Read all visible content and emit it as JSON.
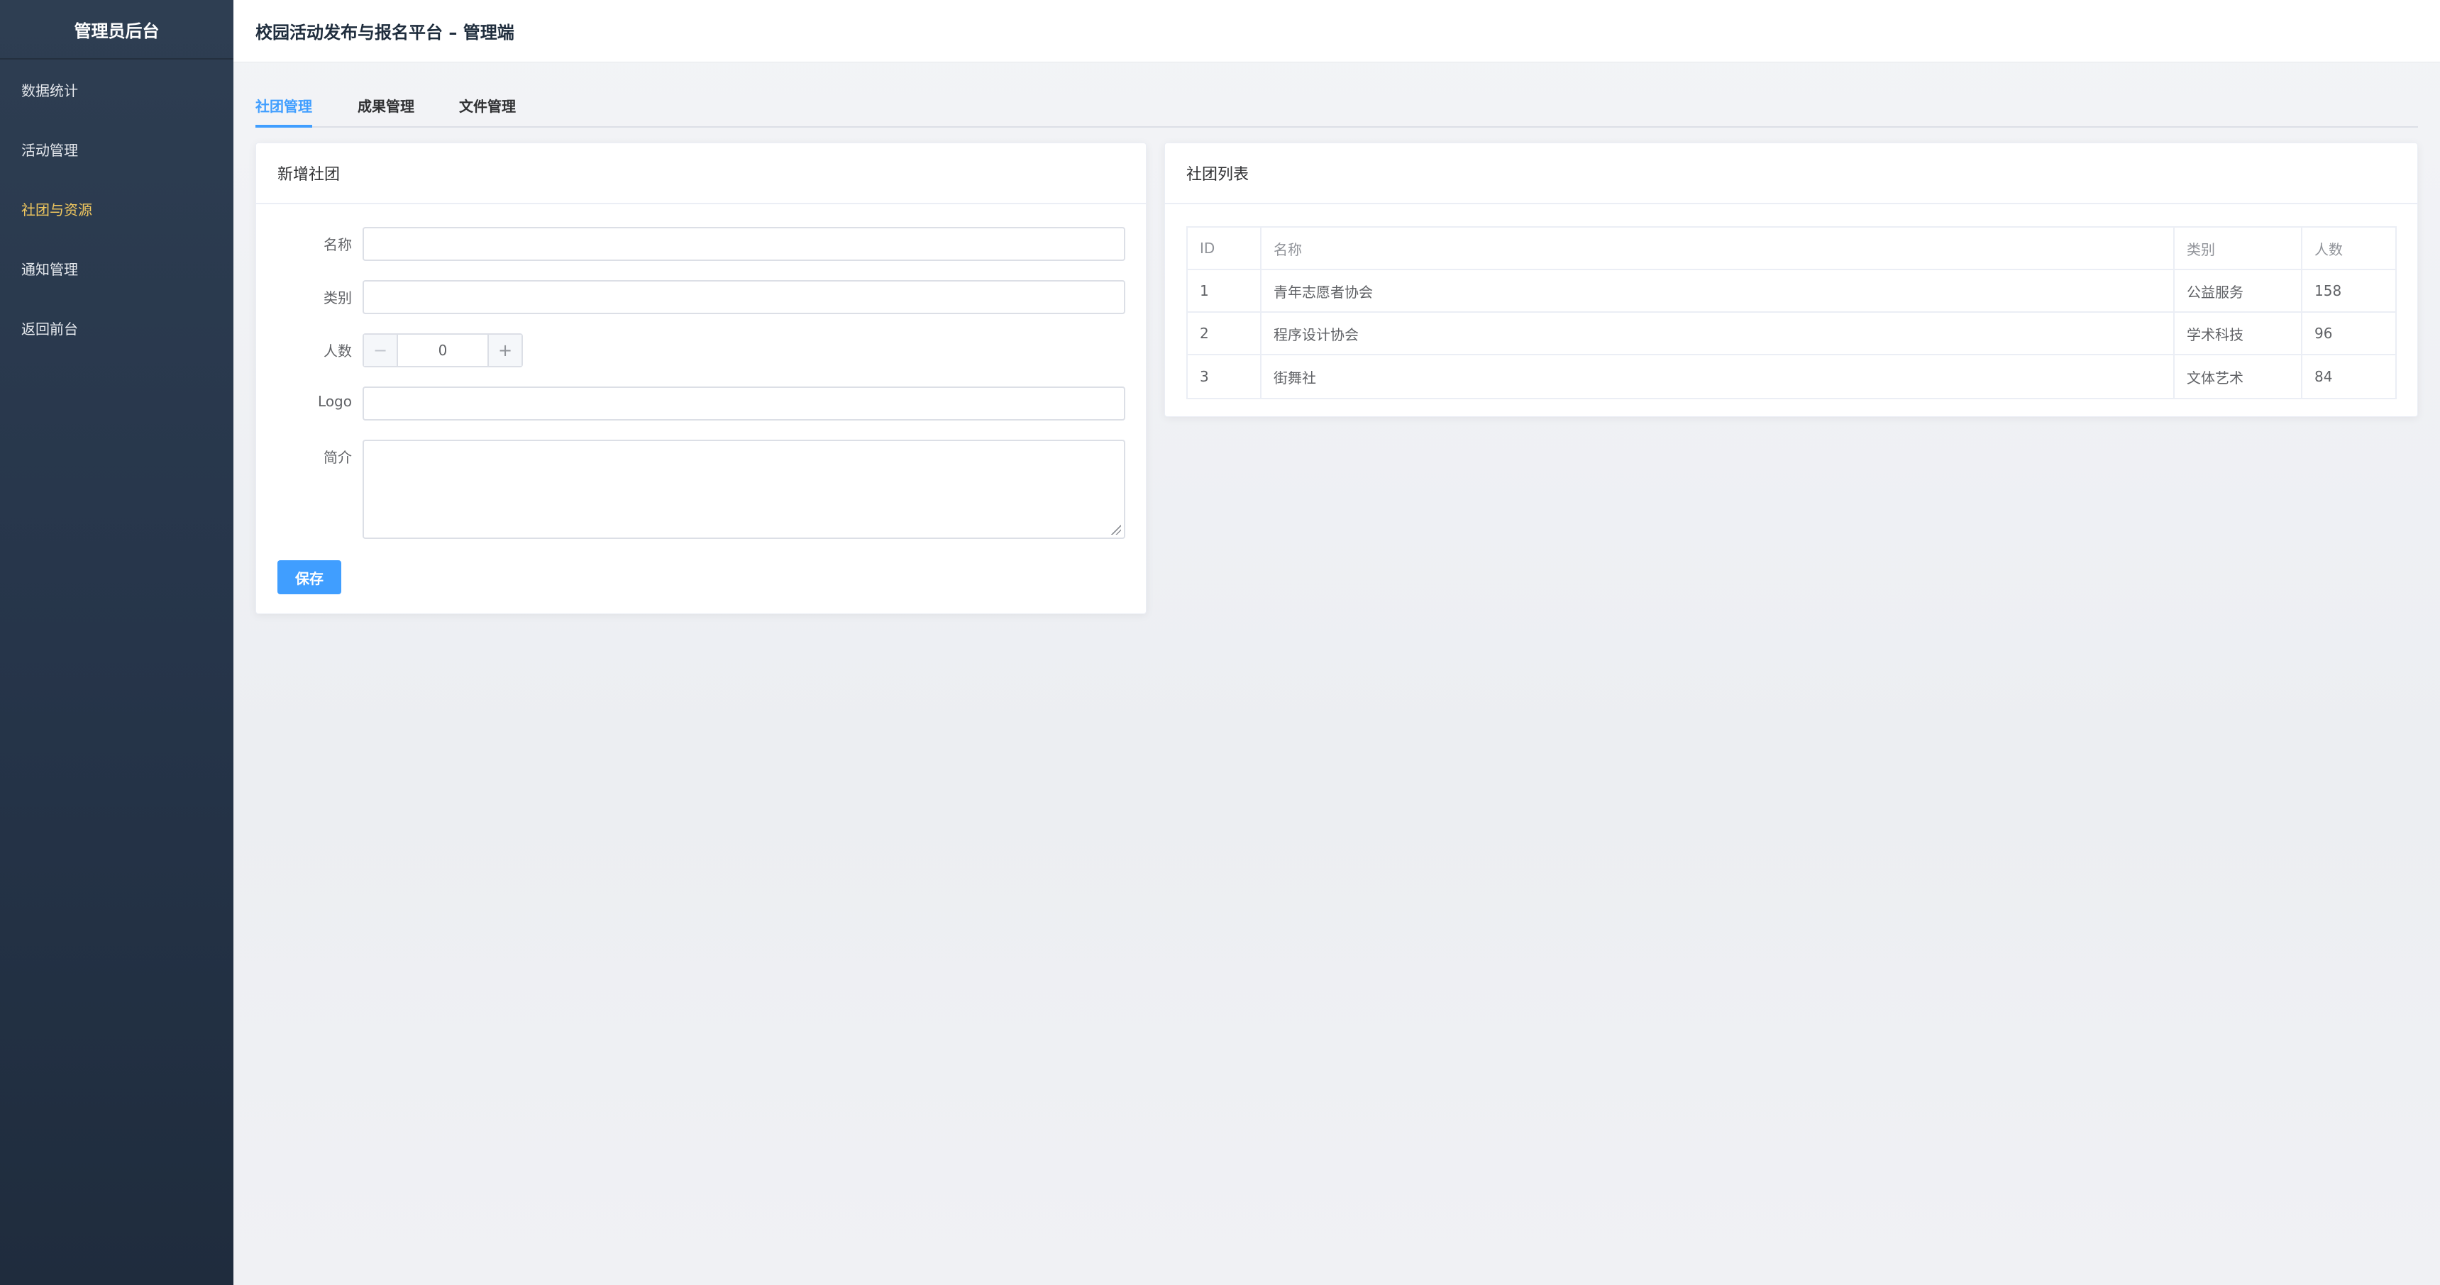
{
  "sidebar": {
    "title": "管理员后台",
    "items": [
      {
        "label": "数据统计",
        "active": false
      },
      {
        "label": "活动管理",
        "active": false
      },
      {
        "label": "社团与资源",
        "active": true
      },
      {
        "label": "通知管理",
        "active": false
      },
      {
        "label": "返回前台",
        "active": false
      }
    ]
  },
  "header": {
    "title": "校园活动发布与报名平台 – 管理端"
  },
  "tabs": [
    {
      "label": "社团管理",
      "active": true
    },
    {
      "label": "成果管理",
      "active": false
    },
    {
      "label": "文件管理",
      "active": false
    }
  ],
  "form": {
    "title": "新增社团",
    "name_label": "名称",
    "name_value": "",
    "category_label": "类别",
    "category_value": "",
    "count_label": "人数",
    "count_value": "0",
    "minus_symbol": "−",
    "plus_symbol": "+",
    "logo_label": "Logo",
    "logo_value": "",
    "intro_label": "简介",
    "intro_value": "",
    "save_label": "保存"
  },
  "list": {
    "title": "社团列表",
    "columns": {
      "id": "ID",
      "name": "名称",
      "category": "类别",
      "count": "人数"
    },
    "rows": [
      {
        "id": "1",
        "name": "青年志愿者协会",
        "category": "公益服务",
        "count": "158"
      },
      {
        "id": "2",
        "name": "程序设计协会",
        "category": "学术科技",
        "count": "96"
      },
      {
        "id": "3",
        "name": "街舞社",
        "category": "文体艺术",
        "count": "84"
      }
    ]
  },
  "colors": {
    "accent": "#409eff",
    "sidebar_active": "#f0c75e",
    "sidebar_bg": "#26354a"
  }
}
